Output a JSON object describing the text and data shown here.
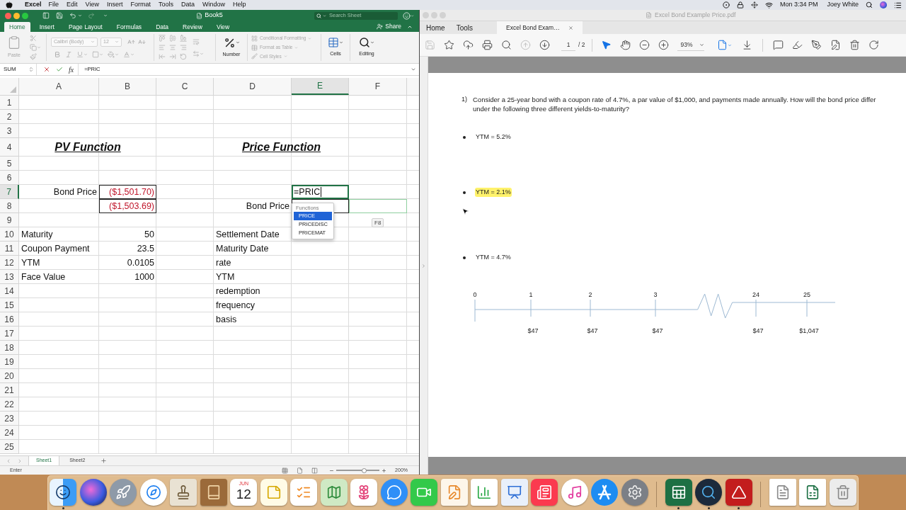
{
  "menu_bar": {
    "app": "Excel",
    "menus": [
      "File",
      "Edit",
      "View",
      "Insert",
      "Format",
      "Tools",
      "Data",
      "Window",
      "Help"
    ],
    "clock": "Mon 3:34 PM",
    "user": "Joey White"
  },
  "excel": {
    "active": true,
    "title": "Book5",
    "search": {
      "placeholder": "Search Sheet"
    },
    "tabs": [
      {
        "label": "Home",
        "selected": true
      },
      {
        "label": "Insert",
        "selected": false
      },
      {
        "label": "Page Layout",
        "selected": false
      },
      {
        "label": "Formulas",
        "selected": false
      },
      {
        "label": "Data",
        "selected": false
      },
      {
        "label": "Review",
        "selected": false
      },
      {
        "label": "View",
        "selected": false
      }
    ],
    "share": "Share",
    "ribbon": {
      "paste": {
        "label": "Paste",
        "disabled": true
      },
      "font": {
        "name": "Calibri (Body)",
        "size": "12",
        "disabled": true
      },
      "alignment": {
        "disabled": true
      },
      "number": {
        "label": "Number"
      },
      "styles": {
        "items": [
          "Conditional Formatting",
          "Format as Table",
          "Cell Styles"
        ],
        "disabled": true
      },
      "cells": {
        "label": "Cells"
      },
      "editing": {
        "label": "Editing"
      }
    },
    "formula_bar": {
      "name_box": "SUM",
      "function_button": "fx",
      "formula": "=PRIC"
    },
    "columns": [
      {
        "label": "A",
        "selected": false
      },
      {
        "label": "B",
        "selected": false
      },
      {
        "label": "C",
        "selected": false
      },
      {
        "label": "D",
        "selected": false
      },
      {
        "label": "E",
        "selected": true
      },
      {
        "label": "F",
        "selected": false
      }
    ],
    "rows": [
      {
        "label": "1",
        "selected": false
      },
      {
        "label": "2",
        "selected": false
      },
      {
        "label": "3",
        "selected": false
      },
      {
        "label": "4",
        "selected": false,
        "cells": [
          {
            "text": "PV Function",
            "kind": "heading"
          },
          null,
          null,
          {
            "text": "Price Function",
            "kind": "heading"
          },
          null,
          null
        ]
      },
      {
        "label": "5",
        "selected": false
      },
      {
        "label": "6",
        "selected": false
      },
      {
        "label": "7",
        "selected": true,
        "cells": [
          {
            "text": "Bond Price",
            "kind": "label"
          },
          {
            "text": "($1,501.70)",
            "kind": "negative",
            "boxed": true
          },
          null,
          null,
          {
            "text": "=PRIC",
            "kind": "editing"
          },
          null
        ]
      },
      {
        "label": "8",
        "selected": false,
        "cells": [
          null,
          {
            "text": "($1,503.69)",
            "kind": "negative",
            "boxed": true
          },
          null,
          {
            "text": "Bond Price",
            "kind": "label"
          },
          {
            "boxed": true
          },
          {
            "kind": "reference"
          }
        ]
      },
      {
        "label": "9",
        "selected": false
      },
      {
        "label": "10",
        "selected": false,
        "cells": [
          {
            "text": "Maturity",
            "kind": "text"
          },
          {
            "text": "50",
            "kind": "number"
          },
          null,
          {
            "text": "Settlement Date",
            "kind": "text"
          },
          null,
          null
        ]
      },
      {
        "label": "11",
        "selected": false,
        "cells": [
          {
            "text": "Coupon Payment",
            "kind": "text"
          },
          {
            "text": "23.5",
            "kind": "number"
          },
          null,
          {
            "text": "Maturity Date",
            "kind": "text"
          },
          null,
          null
        ]
      },
      {
        "label": "12",
        "selected": false,
        "cells": [
          {
            "text": "YTM",
            "kind": "text"
          },
          {
            "text": "0.0105",
            "kind": "number"
          },
          null,
          {
            "text": "rate",
            "kind": "text"
          },
          null,
          null
        ]
      },
      {
        "label": "13",
        "selected": false,
        "cells": [
          {
            "text": "Face Value",
            "kind": "text"
          },
          {
            "text": "1000",
            "kind": "number"
          },
          null,
          {
            "text": "YTM",
            "kind": "text"
          },
          null,
          null
        ]
      },
      {
        "label": "14",
        "selected": false,
        "cells": [
          null,
          null,
          null,
          {
            "text": "redemption",
            "kind": "text"
          },
          null,
          null
        ]
      },
      {
        "label": "15",
        "selected": false,
        "cells": [
          null,
          null,
          null,
          {
            "text": "frequency",
            "kind": "text"
          },
          null,
          null
        ]
      },
      {
        "label": "16",
        "selected": false,
        "cells": [
          null,
          null,
          null,
          {
            "text": "basis",
            "kind": "text"
          },
          null,
          null
        ]
      },
      {
        "label": "17",
        "selected": false
      },
      {
        "label": "18",
        "selected": false
      },
      {
        "label": "19",
        "selected": false
      },
      {
        "label": "20",
        "selected": false
      },
      {
        "label": "21",
        "selected": false
      },
      {
        "label": "22",
        "selected": false
      },
      {
        "label": "23",
        "selected": false
      },
      {
        "label": "24",
        "selected": false
      },
      {
        "label": "25",
        "selected": false
      }
    ],
    "autocomplete": {
      "title": "Functions",
      "items": [
        {
          "label": "PRICE",
          "selected": true
        },
        {
          "label": "PRICEDISC",
          "selected": false
        },
        {
          "label": "PRICEMAT",
          "selected": false
        }
      ]
    },
    "key_hint": "F8",
    "sheets": [
      {
        "label": "Sheet1",
        "selected": true
      },
      {
        "label": "Sheet2",
        "selected": false
      }
    ],
    "status": "Enter",
    "zoom": {
      "level": 0.64,
      "reading": "200%"
    }
  },
  "acrobat": {
    "active": false,
    "title": "Excel Bond Example Price.pdf",
    "tabs": [
      {
        "label": "Home",
        "kind": "nav",
        "selected": false
      },
      {
        "label": "Tools",
        "kind": "nav",
        "selected": false
      },
      {
        "label": "Excel Bond Exam…",
        "kind": "document",
        "selected": true
      }
    ],
    "toolbar": {
      "buttons": [
        {
          "disabled": true
        },
        {
          "disabled": false
        },
        {
          "disabled": false
        },
        {
          "disabled": false
        },
        {
          "disabled": false
        },
        {
          "disabled": true
        },
        {
          "disabled": false
        }
      ],
      "page": "1",
      "page_count": "/ 2",
      "tools": [
        {
          "selected": true
        },
        {
          "selected": false
        }
      ],
      "zoom": "93%"
    },
    "document": {
      "question": {
        "number": "1)",
        "text": "Consider a 25-year bond with a coupon rate of 4.7%, a par value of $1,000, and payments made annually. How will the bond price differ under the following three different yields-to-maturity?"
      },
      "bullets": [
        {
          "text": "YTM = 5.2%",
          "highlighted": false
        },
        {
          "text": "YTM = 2.1%",
          "highlighted": true
        },
        {
          "text": "YTM = 4.7%",
          "highlighted": false
        }
      ],
      "timeline": [
        {
          "period": "0",
          "gap_before": false
        },
        {
          "period": "1",
          "cash_flow": "$47",
          "gap_before": false
        },
        {
          "period": "2",
          "cash_flow": "$47",
          "gap_before": false
        },
        {
          "period": "3",
          "cash_flow": "$47",
          "gap_before": false
        },
        {
          "period": "24",
          "cash_flow": "$47",
          "gap_before": true
        },
        {
          "period": "25",
          "cash_flow": "$1,047",
          "gap_before": false
        }
      ]
    }
  },
  "dock": {
    "items": [
      {
        "running": true
      },
      {
        "running": false
      },
      {
        "running": false
      },
      {
        "running": false
      },
      {
        "running": false
      },
      {
        "running": false
      },
      {
        "running": false,
        "month": "JUN",
        "day": "12"
      },
      {
        "running": false
      },
      {
        "running": false
      },
      {
        "running": false
      },
      {
        "running": false
      },
      {
        "running": false
      },
      {
        "running": false
      },
      {
        "running": false
      },
      {
        "running": false
      },
      {
        "running": false
      },
      {
        "running": false
      },
      {
        "running": false
      },
      {
        "running": false
      },
      {
        "running": false
      },
      {
        "running": true
      },
      {
        "running": true
      },
      {
        "running": true
      },
      {
        "running": false
      },
      {
        "running": false
      },
      {
        "running": false
      }
    ]
  }
}
